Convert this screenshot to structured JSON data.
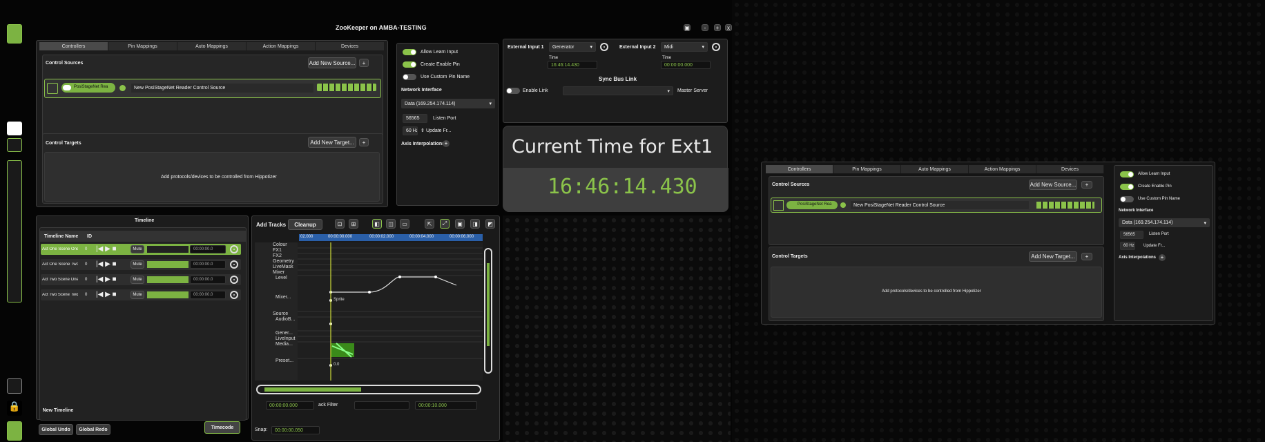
{
  "window": {
    "title": "ZooKeeper on AMBA-TESTING",
    "controls": [
      "-",
      "+",
      "x"
    ]
  },
  "tabs": [
    "Controllers",
    "Pin Mappings",
    "Auto Mappings",
    "Action Mappings",
    "Devices"
  ],
  "control_sources": {
    "heading": "Control Sources",
    "add_button": "Add New Source...",
    "source_type": "PosiStageNet Rea",
    "source_name": "New PosiStageNet Reader Control Source"
  },
  "control_targets": {
    "heading": "Control Targets",
    "add_button": "Add New Target...",
    "empty_text": "Add protocols/devices to be controlled from Hippotizer"
  },
  "settings": {
    "allow_learn": "Allow Learn Input",
    "create_enable": "Create Enable Pin",
    "custom_pin": "Use Custom Pin Name",
    "network_label": "Network Interface",
    "network_value": "Data (169.254.174.114)",
    "port_value": "56565",
    "port_label": "Listen Port",
    "rate_value": "60 Hz",
    "rate_label": "Update Fr...",
    "axis_label": "Axis Interpolations"
  },
  "external": {
    "in1_label": "External Input 1",
    "in1_value": "Generator",
    "in2_label": "External Input 2",
    "in2_value": "Midi",
    "time_label": "Time",
    "time1": "16:46:14.430",
    "time2": "00:00:00.000",
    "sync_label": "Sync Bus Link",
    "enable_link": "Enable Link",
    "master": "Master Server"
  },
  "clock": {
    "title": "Current Time for Ext1",
    "time": "16:46:14.430"
  },
  "timeline": {
    "title": "Timeline",
    "col_name": "Timeline Name",
    "col_id": "ID",
    "rows": [
      {
        "name": "Act One Scene One",
        "id": "0",
        "mute": "Mute",
        "time": "00:00:00.0"
      },
      {
        "name": "Act One Scene Two",
        "id": "0",
        "mute": "Mute",
        "time": "00:00:00.0"
      },
      {
        "name": "Act Two Scene One",
        "id": "0",
        "mute": "Mute",
        "time": "00:00:00.0"
      },
      {
        "name": "Act Two Scene Two",
        "id": "0",
        "mute": "Mute",
        "time": "00:00:00.0"
      }
    ],
    "new_timeline": "New Timeline",
    "undo": "Global Undo",
    "redo": "Global Redo",
    "timecode": "Timecode"
  },
  "editor": {
    "add_tracks": "Add Tracks",
    "cleanup": "Cleanup",
    "ruler": [
      "02.000",
      "00:00:00.000",
      "00:00:02.000",
      "00:00:04.000",
      "00:00:06.000"
    ],
    "tracks": [
      "Colour",
      "FX1",
      "FX2",
      "Geometry",
      "LiveMask",
      "Mixer",
      "Level",
      "Mixer...",
      "Source",
      "AudioB...",
      "Gener...",
      "LiveInput",
      "Media...",
      "Preset..."
    ],
    "sprite_label": "Sprite",
    "preset_value": "0.0",
    "start_time": "00:00:00.000",
    "end_time": "00:00:10.000",
    "track_filter": "ack Filter",
    "snap_label": "Snap:",
    "snap_value": "00:00:00.050"
  },
  "colors": {
    "accent": "#8bc34a",
    "panel": "#1c1c1c",
    "background": "#050505"
  }
}
